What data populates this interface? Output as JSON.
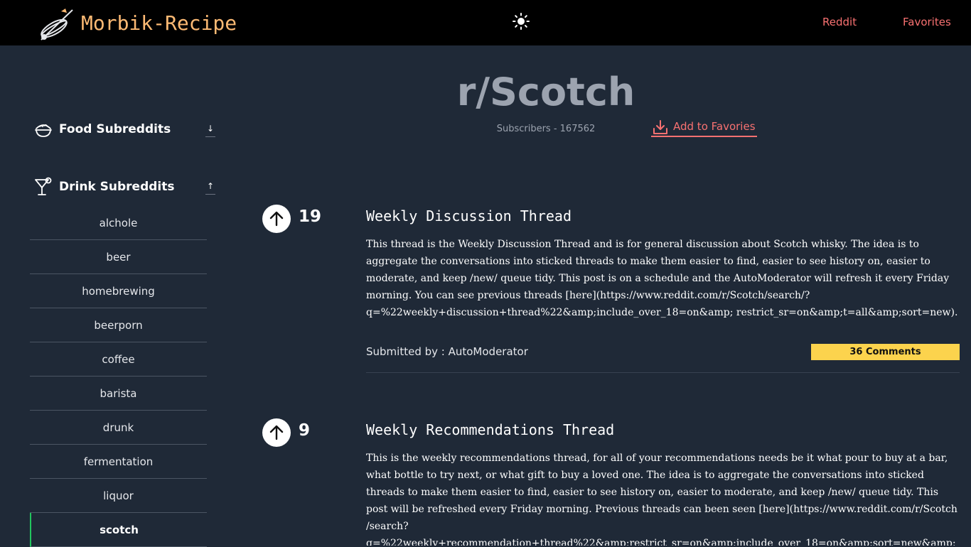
{
  "header": {
    "brand": "Morbik-Recipe",
    "nav": {
      "reddit": "Reddit",
      "favorites": "Favorites"
    }
  },
  "sidebar": {
    "food": {
      "title": "Food Subreddits",
      "toggle": "↓"
    },
    "drink": {
      "title": "Drink Subreddits",
      "toggle": "↑"
    },
    "items": [
      {
        "label": "alchole"
      },
      {
        "label": "beer"
      },
      {
        "label": "homebrewing"
      },
      {
        "label": "beerporn"
      },
      {
        "label": "coffee"
      },
      {
        "label": "barista"
      },
      {
        "label": "drunk"
      },
      {
        "label": "fermentation"
      },
      {
        "label": "liquor"
      },
      {
        "label": "scotch"
      }
    ],
    "active": "scotch"
  },
  "subreddit": {
    "title": "r/Scotch",
    "subscribers": "Subscribers - 167562",
    "add_favorite": "Add to Favories"
  },
  "posts": [
    {
      "votes": "19",
      "title": "Weekly Discussion Thread",
      "body": "This thread is the Weekly Discussion Thread and is for general discussion about Scotch whisky. The idea is to aggregate the conversations into sticked threads to make them easier to find, easier to see history on, easier to moderate, and keep /new/ queue tidy. This post is on a schedule and the AutoModerator will refresh it every Friday morning. You can see previous threads [here](https://www.reddit.com/r/Scotch/search/?q=%22weekly+discussion+thread%22&amp;include_over_18=on&amp; restrict_sr=on&amp;t=all&amp;sort=new).",
      "submitted": "Submitted by : AutoModerator",
      "comments": "36 Comments"
    },
    {
      "votes": "9",
      "title": "Weekly Recommendations Thread",
      "body": "This is the weekly recommendations thread, for all of your recommendations needs be it what pour to buy at a bar, what bottle to try next, or what gift to buy a loved one. The idea is to aggregate the conversations into sticked threads to make them easier to find, easier to see history on, easier to moderate, and keep /new/ queue tidy. This post will be refreshed every Friday morning. Previous threads can been seen [here](https://www.reddit.com/r/Scotch /search?q=%22weekly+recommendation+thread%22&amp;restrict_sr=on&amp;include_over_18=on&amp;sort=new&amp; t=all)."
    }
  ],
  "colors": {
    "background": "#1f2937",
    "topbar": "#000000",
    "brand": "#fdba74",
    "accent": "#f87171",
    "comments_badge": "#fcd34d",
    "active_marker": "#22c55e"
  },
  "icons": {
    "logo": "whisk-spoon-icon",
    "theme_toggle": "sun-icon",
    "food": "food-bowl-icon",
    "drink": "cocktail-icon",
    "vote": "arrow-up-icon",
    "favorite": "download-icon"
  }
}
